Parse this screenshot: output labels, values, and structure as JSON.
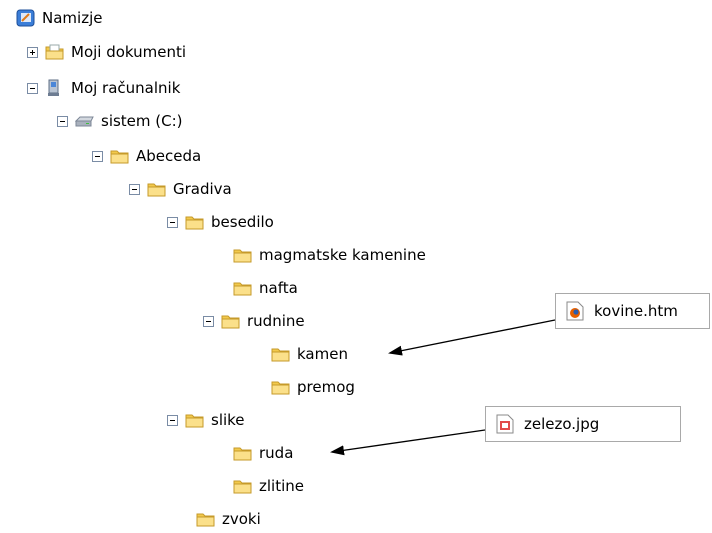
{
  "tree": {
    "desktop": "Namizje",
    "my_documents": "Moji dokumenti",
    "my_computer": "Moj računalnik",
    "drive": "sistem (C:)",
    "abeceda": "Abeceda",
    "gradiva": "Gradiva",
    "besedilo": "besedilo",
    "magmatske": "magmatske kamenine",
    "nafta": "nafta",
    "rudnine": "rudnine",
    "kamen": "kamen",
    "premog": "premog",
    "slike": "slike",
    "ruda": "ruda",
    "zlitine": "zlitine",
    "zvoki": "zvoki"
  },
  "callouts": {
    "kovine": "kovine.htm",
    "zelezo": "zelezo.jpg"
  },
  "icons": {
    "desktop": "desktop-icon",
    "documents": "documents-folder-icon",
    "computer": "computer-icon",
    "drive": "hard-drive-icon",
    "folder": "folder-icon",
    "htm_file": "firefox-html-file-icon",
    "jpg_file": "image-file-icon"
  },
  "colors": {
    "folder_fill": "#f7d56d",
    "folder_edge": "#c69a2a",
    "arrow": "#000000"
  }
}
